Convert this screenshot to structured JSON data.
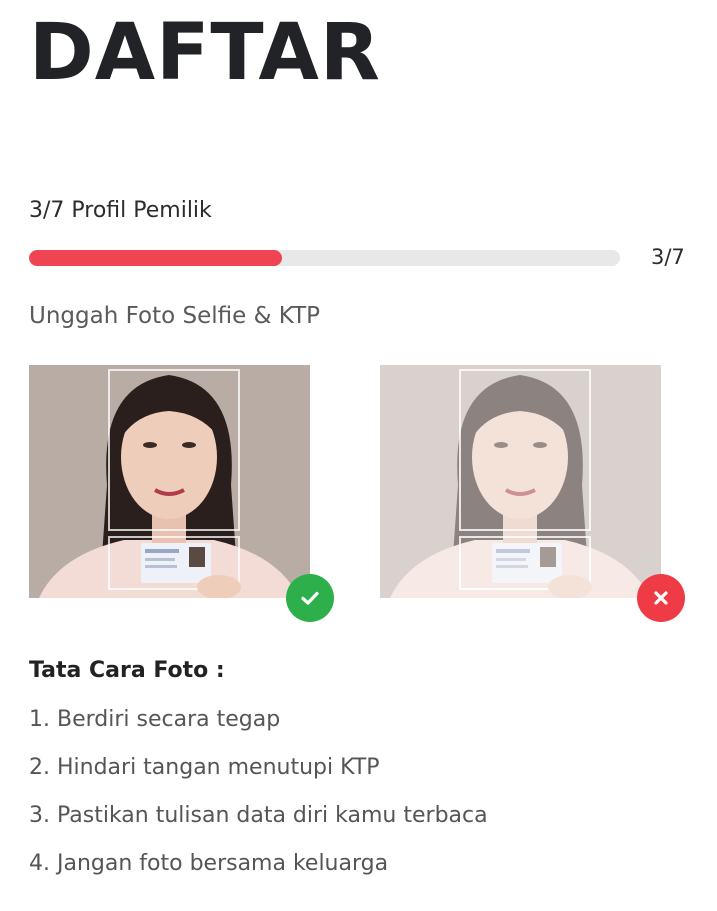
{
  "page": {
    "title": "DAFTAR"
  },
  "progress": {
    "step_label": "3/7 Profil Pemilik",
    "count_label": "3/7",
    "current": 3,
    "total": 7,
    "fill_color": "#ef4452"
  },
  "upload": {
    "label": "Unggah Foto Selfie & KTP",
    "good_example": {
      "status_icon": "check-icon",
      "status_color": "#2db04b"
    },
    "bad_example": {
      "status_icon": "close-icon",
      "status_color": "#ee3b45"
    }
  },
  "instructions": {
    "title": "Tata Cara Foto :",
    "items": [
      "1. Berdiri secara tegap",
      "2. Hindari tangan menutupi KTP",
      "3. Pastikan tulisan data diri kamu terbaca",
      "4. Jangan foto bersama keluarga"
    ]
  }
}
